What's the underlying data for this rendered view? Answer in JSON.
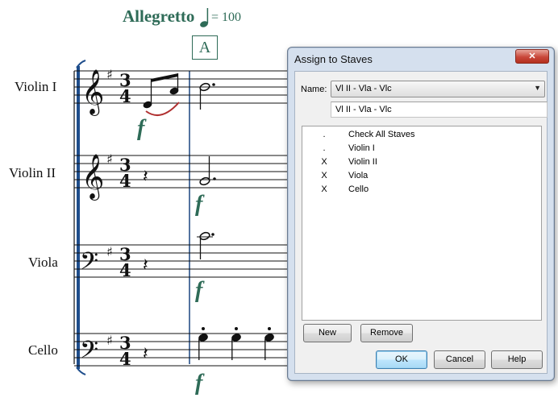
{
  "score": {
    "tempo": {
      "text": "Allegretto",
      "value": "= 100"
    },
    "rehearsal_mark": "A",
    "instruments": [
      "Violin I",
      "Violin II",
      "Viola",
      "Cello"
    ],
    "dynamic": "f",
    "time_signature": {
      "top": "3",
      "bottom": "4"
    },
    "colors": {
      "accent": "#2e6b57",
      "slur": "#b03030",
      "barline": "#1f4e8c"
    }
  },
  "dialog": {
    "title": "Assign to Staves",
    "close_icon": "close-icon",
    "name_label": "Name:",
    "name_selected": "Vl II - Vla - Vlc",
    "name_input_value": "Vl II - Vla - Vlc",
    "rows": [
      {
        "mark": ".",
        "label": "Check All Staves"
      },
      {
        "mark": ".",
        "label": "Violin I"
      },
      {
        "mark": "X",
        "label": "Violin II"
      },
      {
        "mark": "X",
        "label": "Viola"
      },
      {
        "mark": "X",
        "label": "Cello"
      }
    ],
    "buttons": {
      "new": "New",
      "remove": "Remove",
      "ok": "OK",
      "cancel": "Cancel",
      "help": "Help"
    }
  }
}
